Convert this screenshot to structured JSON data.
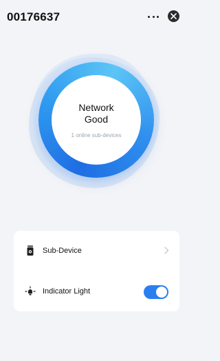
{
  "header": {
    "title": "00176637",
    "more_icon": "more-horizontal-icon",
    "close_icon": "close-circle-icon"
  },
  "network": {
    "title": "Network",
    "status": "Good",
    "subtitle": "1 online sub-devices",
    "ring_colors": [
      "#1f6ee3",
      "#5cc5f6"
    ]
  },
  "settings": {
    "items": [
      {
        "label": "Sub-Device",
        "icon": "sub-device-icon",
        "control": "chevron"
      },
      {
        "label": "Indicator Light",
        "icon": "indicator-light-icon",
        "control": "toggle",
        "enabled": true
      }
    ]
  },
  "colors": {
    "accent": "#2a7ff0",
    "background": "#f3f4f7"
  }
}
